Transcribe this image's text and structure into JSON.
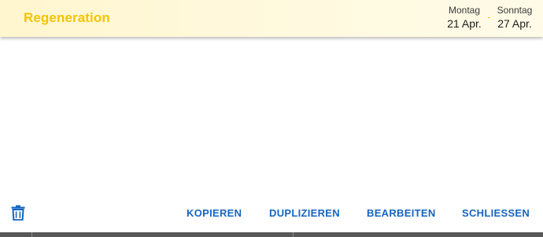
{
  "header": {
    "title": "Regeneration",
    "start": {
      "weekday": "Montag",
      "date": "21 Apr."
    },
    "end": {
      "weekday": "Sonntag",
      "date": "27 Apr."
    },
    "separator": "-"
  },
  "actions": {
    "delete_icon": "trash-icon",
    "copy_label": "KOPIEREN",
    "duplicate_label": "DUPLIZIEREN",
    "edit_label": "BEARBEITEN",
    "close_label": "SCHLIESSEN"
  },
  "colors": {
    "title": "#f5c400",
    "header_bg": "#fff8d8",
    "action": "#1565c0",
    "bottom_strip": "#585858"
  }
}
